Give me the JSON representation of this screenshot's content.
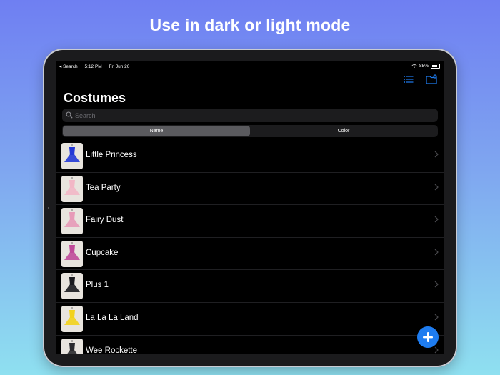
{
  "headline": "Use in dark or light mode",
  "status_bar": {
    "back_label": "◂ Search",
    "time": "5:12 PM",
    "date": "Fri Jun 26",
    "battery": "85%"
  },
  "toolbar": {
    "icons": [
      "list-icon",
      "folder-add-icon"
    ]
  },
  "page_title": "Costumes",
  "search": {
    "placeholder": "Search",
    "value": ""
  },
  "sort_segments": {
    "options": [
      "Name",
      "Color"
    ],
    "selected": "Name"
  },
  "costumes": [
    {
      "name": "Little Princess",
      "dress_color": "#2438d6"
    },
    {
      "name": "Tea Party",
      "dress_color": "#f2b7c6"
    },
    {
      "name": "Fairy Dust",
      "dress_color": "#e79ab8"
    },
    {
      "name": "Cupcake",
      "dress_color": "#c04a9a"
    },
    {
      "name": "Plus 1",
      "dress_color": "#1a1a1f"
    },
    {
      "name": "La La La Land",
      "dress_color": "#f2d21c"
    },
    {
      "name": "Wee Rockette",
      "dress_color": "#2a2a2e"
    }
  ],
  "accent_color": "#1e7cf0"
}
